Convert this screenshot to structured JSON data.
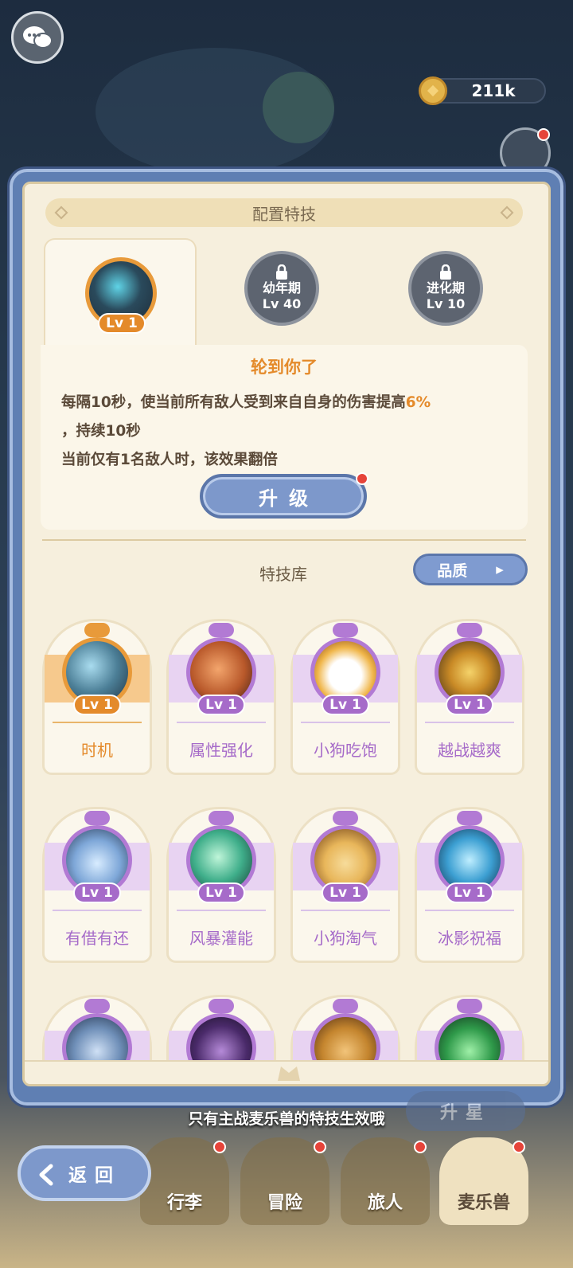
{
  "top": {
    "coins": "211k",
    "chat_icon": "chat-bubbles-icon"
  },
  "panel": {
    "title": "配置特技",
    "active_slot": {
      "level": "Lv 1"
    },
    "locked_slots": [
      {
        "stage": "幼年期",
        "level": "Lv 40"
      },
      {
        "stage": "进化期",
        "level": "Lv 10"
      }
    ],
    "skill": {
      "name": "轮到你了",
      "desc1_pre": "每隔10秒，使当前所有敌人受到来自自身的伤害提高",
      "desc1_hl": "6%",
      "desc2": "，持续10秒",
      "desc3": "当前仅有1名敌人时，该效果翻倍",
      "upgrade_label": "升级"
    },
    "library_title": "特技库",
    "quality_label": "品质"
  },
  "cards": [
    {
      "name": "时机",
      "level": "Lv 1"
    },
    {
      "name": "属性强化",
      "level": "Lv 1"
    },
    {
      "name": "小狗吃饱",
      "level": "Lv 1"
    },
    {
      "name": "越战越爽",
      "level": "Lv 1"
    },
    {
      "name": "有借有还",
      "level": "Lv 1"
    },
    {
      "name": "风暴灌能",
      "level": "Lv 1"
    },
    {
      "name": "小狗淘气",
      "level": "Lv 1"
    },
    {
      "name": "冰影祝福",
      "level": "Lv 1"
    }
  ],
  "bottom": {
    "message": "只有主战麦乐兽的特技生效哦",
    "behind_button": "升星",
    "back_label": "返回",
    "nav": [
      "行李",
      "冒险",
      "旅人",
      "麦乐兽"
    ]
  },
  "colors": {
    "orange": "#e48a2a",
    "purple": "#b27ad4",
    "blue_button": "#7d98cb"
  }
}
